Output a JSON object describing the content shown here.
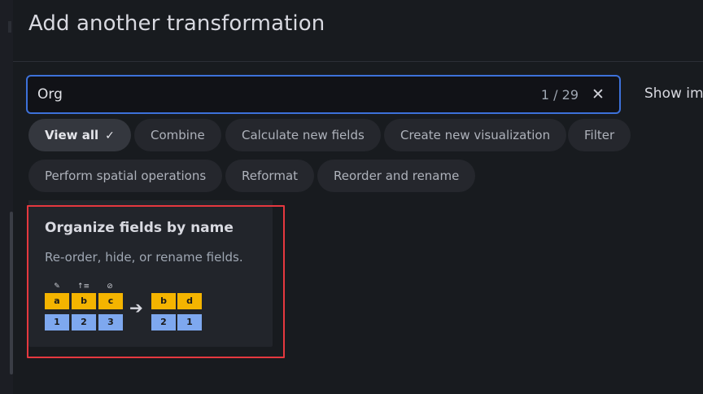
{
  "drawer": {
    "title": "Add another transformation"
  },
  "search": {
    "value": "Org",
    "match_count": "1 / 29",
    "clear_icon": "close-icon"
  },
  "show_images_label": "Show im",
  "chips": [
    {
      "label": "View all",
      "active": true,
      "icon": "checkmark-icon"
    },
    {
      "label": "Combine"
    },
    {
      "label": "Calculate new fields"
    },
    {
      "label": "Create new visualization"
    },
    {
      "label": "Filter"
    },
    {
      "label": "Perform spatial operations"
    },
    {
      "label": "Reformat"
    },
    {
      "label": "Reorder and rename"
    }
  ],
  "card": {
    "title": "Organize fields by name",
    "description": "Re-order, hide, or rename fields.",
    "illustration": {
      "before_headers": [
        "a",
        "b",
        "c"
      ],
      "before_values": [
        "1",
        "2",
        "3"
      ],
      "after_headers": [
        "b",
        "d"
      ],
      "after_values": [
        "2",
        "1"
      ],
      "icons": [
        "pencil-icon",
        "reorder-icon",
        "eye-slash-icon"
      ],
      "header_color": "#f4b400",
      "value_color": "#7ea8ef"
    }
  },
  "colors": {
    "accent": "#3d71d9",
    "highlight": "#e5383f",
    "background": "#181b1f"
  }
}
